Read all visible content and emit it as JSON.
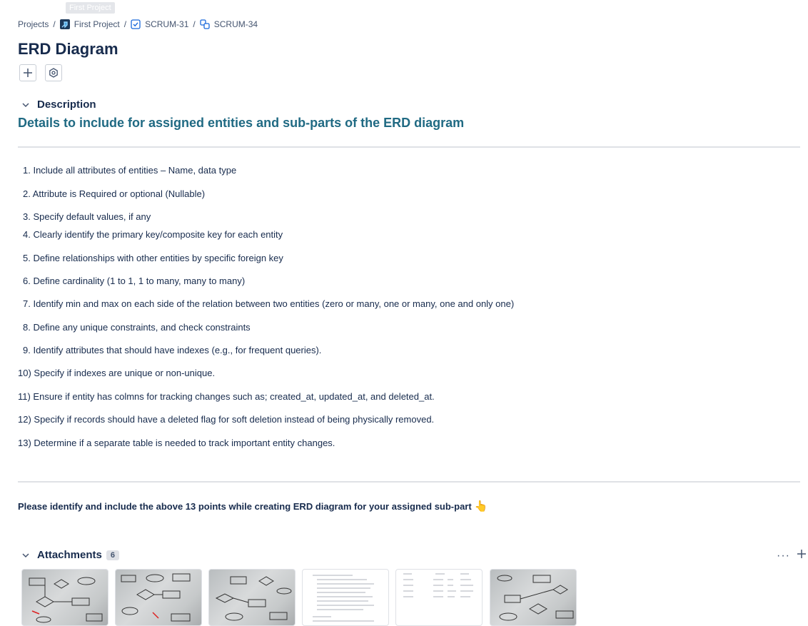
{
  "tooltip": "First Project",
  "breadcrumb": {
    "projects": "Projects",
    "project": "First Project",
    "parent": "SCRUM-31",
    "current": "SCRUM-34",
    "sep": "/"
  },
  "title": "ERD Diagram",
  "description": {
    "label": "Description",
    "heading": "Details to include for assigned entities and sub-parts of the ERD diagram",
    "items": [
      "1. Include all attributes of entities – Name, data type",
      "2. Attribute is Required or optional (Nullable)",
      "3. Specify default values, if any",
      "4. Clearly identify the primary key/composite key for each entity",
      "5. Define relationships with other entities by specific foreign key",
      "6. Define cardinality (1 to 1, 1 to many, many to many)",
      "7. Identify min and max on each side of the relation between two entities (zero or many, one or many, one and only one)",
      "8. Define any unique constraints, and check constraints",
      "9. Identify attributes that should have indexes (e.g., for frequent queries).",
      "10)  Specify if indexes are unique or non-unique.",
      "11)  Ensure if entity has colmns for tracking changes such as; created_at, updated_at, and deleted_at.",
      "12)   Specify if records should have a deleted flag for soft deletion instead of being physically removed.",
      "13)  Determine if a separate table is needed to track important entity changes."
    ],
    "note": "Please identify and include the above 13 points while creating ERD diagram for your assigned sub-part",
    "note_emoji": "👆"
  },
  "attachments": {
    "label": "Attachments",
    "count": "6",
    "more": "···"
  },
  "colors": {
    "heading": "#206a83",
    "text": "#172b4d",
    "rule": "#dfe1e6"
  }
}
